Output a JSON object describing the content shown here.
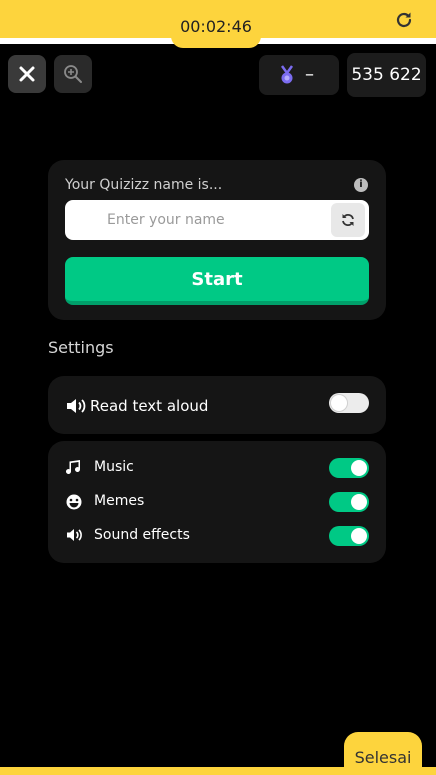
{
  "header": {
    "timer": "00:02:46",
    "game_code": "535 622",
    "medal_value": "–"
  },
  "name_card": {
    "label": "Your Quizizz name is...",
    "input_placeholder": "Enter your name",
    "input_value": "",
    "start_label": "Start"
  },
  "settings": {
    "title": "Settings",
    "read_aloud": {
      "label": "Read text aloud",
      "enabled": false
    },
    "items": [
      {
        "label": "Music",
        "icon": "music-note-icon",
        "enabled": true
      },
      {
        "label": "Memes",
        "icon": "emoji-face-icon",
        "enabled": true
      },
      {
        "label": "Sound effects",
        "icon": "speaker-icon",
        "enabled": true
      }
    ]
  },
  "footer": {
    "finish_label": "Selesai"
  },
  "colors": {
    "accent_yellow": "#fdd43d",
    "toggle_on": "#00c985",
    "start_button": "#00c985",
    "background": "#000000",
    "card": "#151515"
  }
}
